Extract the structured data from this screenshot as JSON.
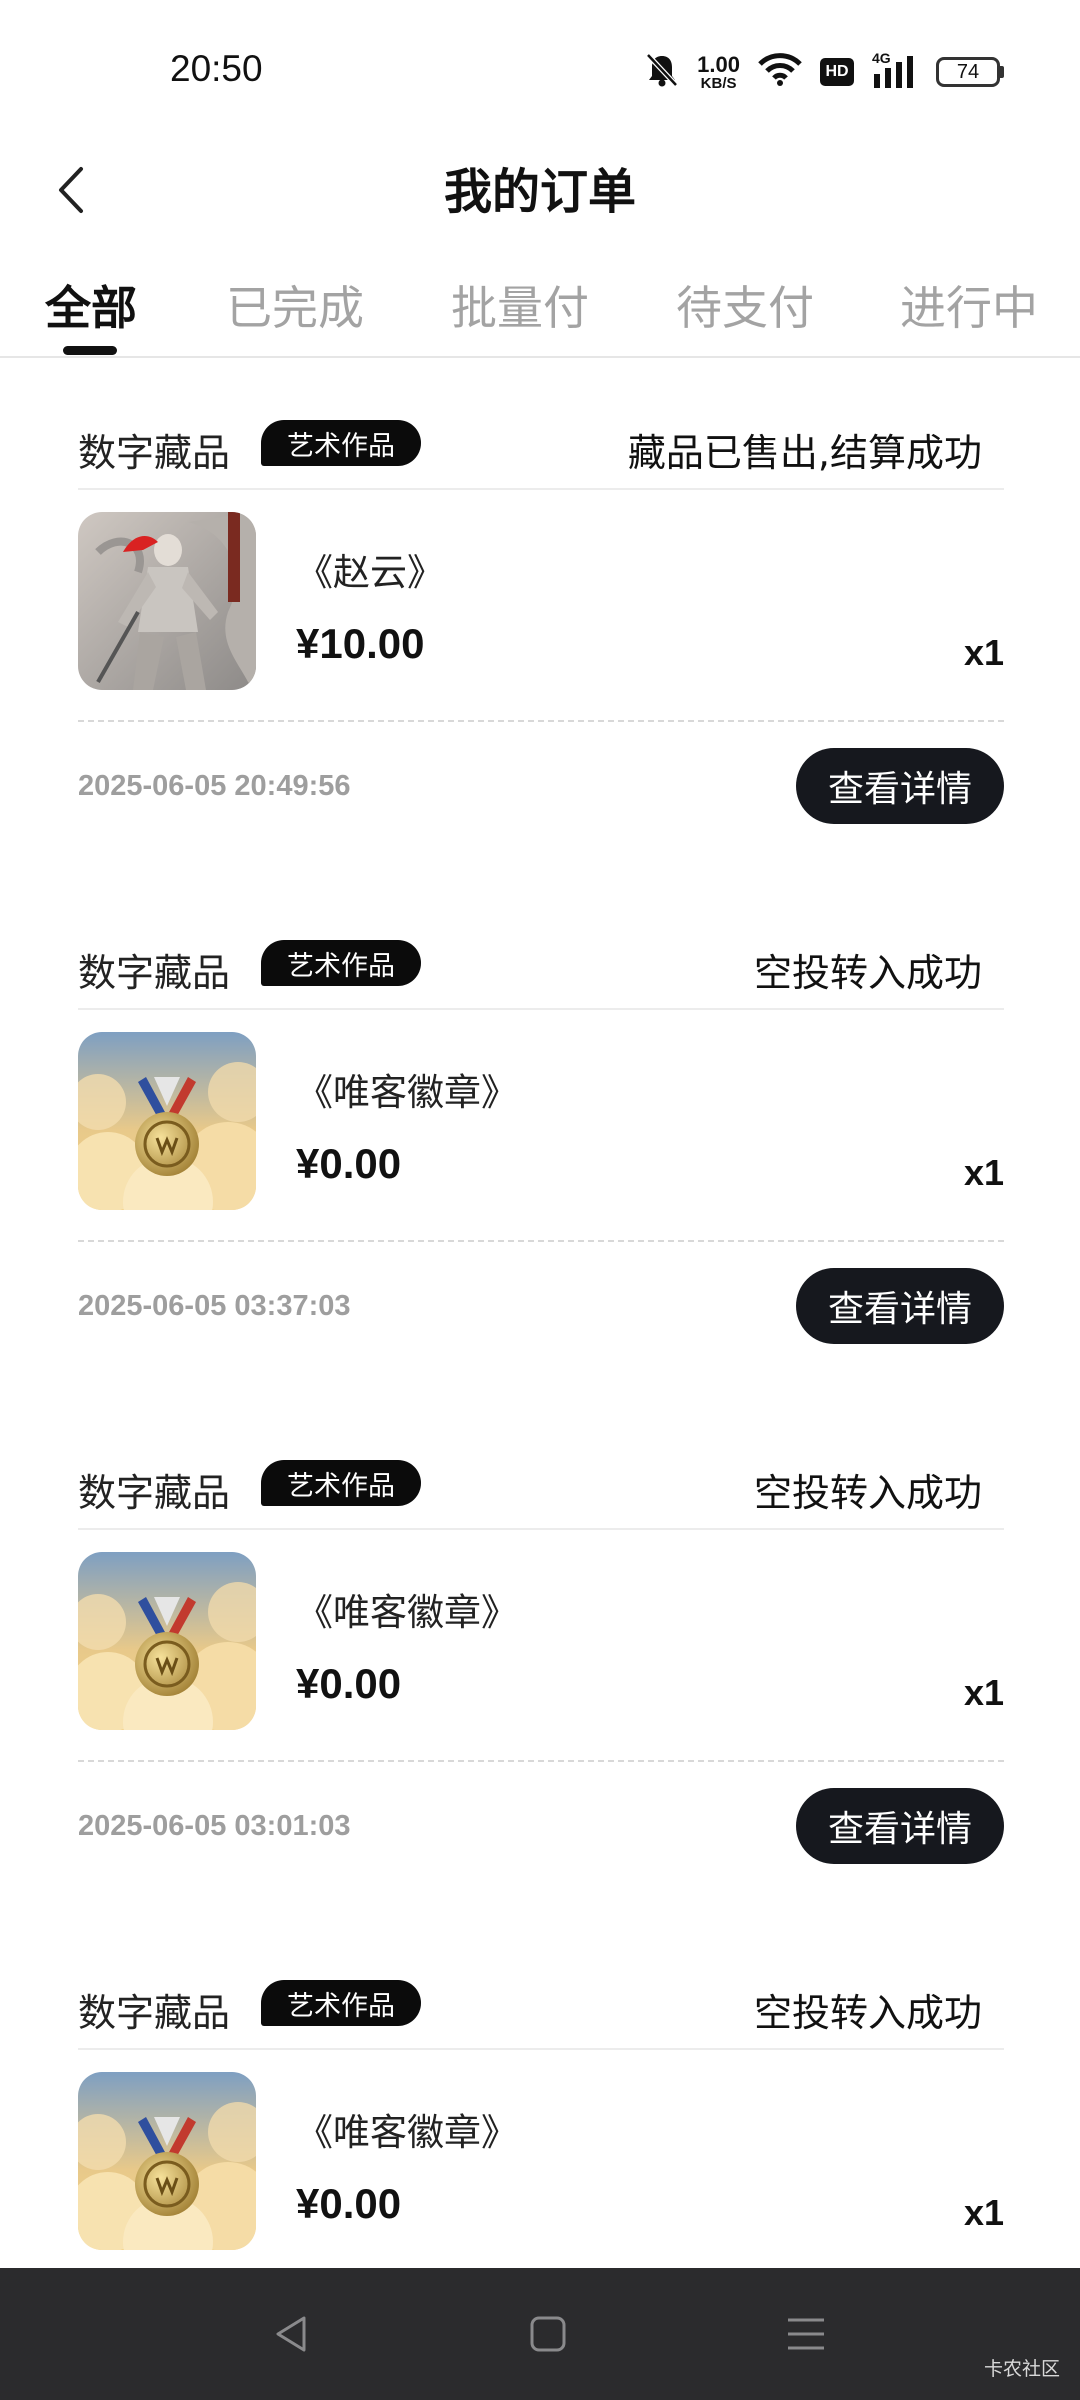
{
  "status_bar": {
    "time": "20:50",
    "net_speed_value": "1.00",
    "net_speed_unit": "KB/S",
    "hd": "HD",
    "network": "4G",
    "battery": "74",
    "icons": [
      "bell-muted-icon",
      "wifi-icon",
      "signal-icon",
      "battery-icon"
    ]
  },
  "header": {
    "title": "我的订单",
    "back_icon": "back-chevron-icon"
  },
  "tabs": [
    {
      "label": "全部",
      "active": true
    },
    {
      "label": "已完成",
      "active": false
    },
    {
      "label": "批量付",
      "active": false
    },
    {
      "label": "待支付",
      "active": false
    },
    {
      "label": "进行中",
      "active": false
    }
  ],
  "orders": [
    {
      "category": "数字藏品",
      "tag": "艺术作品",
      "status": "藏品已售出,结算成功",
      "name": "《赵云》",
      "price": "¥10.00",
      "qty": "x1",
      "time": "2025-06-05 20:49:56",
      "button": "查看详情",
      "image": "warrior-artwork"
    },
    {
      "category": "数字藏品",
      "tag": "艺术作品",
      "status": "空投转入成功",
      "name": "《唯客徽章》",
      "price": "¥0.00",
      "qty": "x1",
      "time": "2025-06-05 03:37:03",
      "button": "查看详情",
      "image": "medal-artwork"
    },
    {
      "category": "数字藏品",
      "tag": "艺术作品",
      "status": "空投转入成功",
      "name": "《唯客徽章》",
      "price": "¥0.00",
      "qty": "x1",
      "time": "2025-06-05 03:01:03",
      "button": "查看详情",
      "image": "medal-artwork"
    },
    {
      "category": "数字藏品",
      "tag": "艺术作品",
      "status": "空投转入成功",
      "name": "《唯客徽章》",
      "price": "¥0.00",
      "qty": "x1",
      "image": "medal-artwork"
    }
  ],
  "system_nav": {
    "icons": [
      "back-triangle-icon",
      "home-square-icon",
      "menu-lines-icon"
    ],
    "watermark": "卡农社区"
  },
  "colors": {
    "accent": "#111111",
    "inactive_tab": "#a3a3a3",
    "button_bg": "#16181e",
    "nav_bg": "#2b2b2d"
  }
}
